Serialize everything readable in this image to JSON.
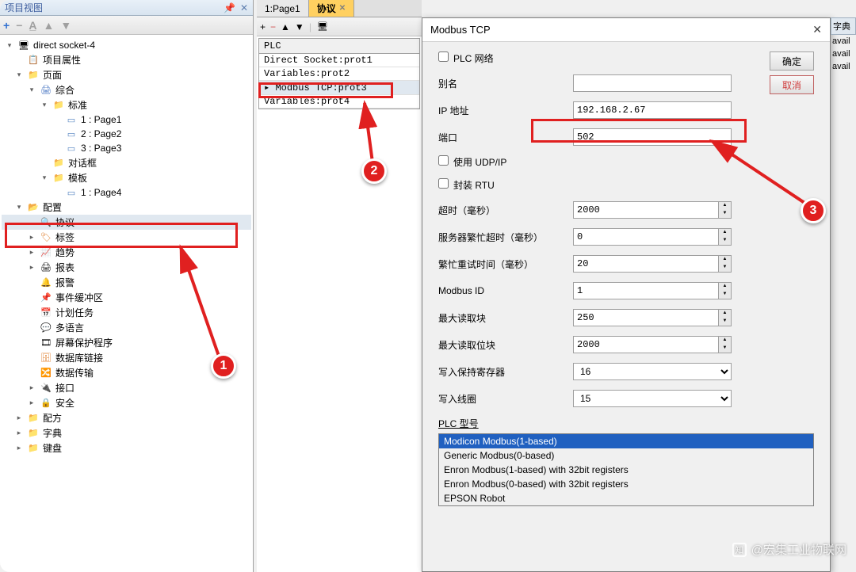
{
  "panel": {
    "title": "项目视图",
    "pin": "📌",
    "close": "✕"
  },
  "toolbarIcons": {
    "plus": "+",
    "minus": "−",
    "up": "▲",
    "down": "▼"
  },
  "tree": {
    "root": "direct socket-4",
    "projProps": "项目属性",
    "pages": "页面",
    "zonghe": "综合",
    "biaozhun": "标准",
    "page1": "1 : Page1",
    "page2": "2 : Page2",
    "page3": "3 : Page3",
    "duihuakuang": "对话框",
    "muban": "模板",
    "page4": "1 : Page4",
    "peizhi": "配置",
    "xieyi": "协议",
    "biaoqian": "标签",
    "qushi": "趋势",
    "baobiao": "报表",
    "baojing": "报警",
    "shijian": "事件缓冲区",
    "jihua": "计划任务",
    "duoyuyan": "多语言",
    "pingbao": "屏幕保护程序",
    "shujuku": "数据库链接",
    "shuju": "数据传输",
    "jiekou": "接口",
    "anquan": "安全",
    "peifang": "配方",
    "zidian": "字典",
    "jianpan": "键盘"
  },
  "tabs": {
    "tab1": "1:Page1",
    "tab2": "协议"
  },
  "plcList": {
    "header": "PLC",
    "r1": "Direct Socket:prot1",
    "r2": "Variables:prot2",
    "r3": "Modbus TCP:prot3",
    "r4": "Variables:prot4"
  },
  "dialog": {
    "title": "Modbus TCP",
    "plcNetwork": "PLC 网络",
    "alias": "别名",
    "aliasVal": "",
    "ipLabel": "IP 地址",
    "ipVal": "192.168.2.67",
    "portLabel": "端口",
    "portVal": "502",
    "useUdp": "使用 UDP/IP",
    "encapRtu": "封装 RTU",
    "timeout": "超时（毫秒）",
    "timeoutVal": "2000",
    "busyTimeout": "服务器繁忙超时（毫秒）",
    "busyTimeoutVal": "0",
    "retryTime": "繁忙重试时间（毫秒）",
    "retryTimeVal": "20",
    "modbusId": "Modbus ID",
    "modbusIdVal": "1",
    "maxReadBlock": "最大读取块",
    "maxReadBlockVal": "250",
    "maxReadBit": "最大读取位块",
    "maxReadBitVal": "2000",
    "writeHold": "写入保持寄存器",
    "writeHoldVal": "16",
    "writeCoil": "写入线圈",
    "writeCoilVal": "15",
    "plcModel": "PLC 型号",
    "models": {
      "m1": "Modicon Modbus(1-based)",
      "m2": "Generic Modbus(0-based)",
      "m3": "Enron Modbus(1-based) with 32bit registers",
      "m4": "Enron Modbus(0-based) with 32bit registers",
      "m5": "EPSON Robot"
    },
    "ok": "确定",
    "cancel": "取消"
  },
  "rightSliver": {
    "zidian": "字典",
    "a1": "avail",
    "a2": "avail",
    "a3": "avail"
  },
  "watermark": "@宏集工业物联网",
  "annot": {
    "n1": "1",
    "n2": "2",
    "n3": "3"
  }
}
